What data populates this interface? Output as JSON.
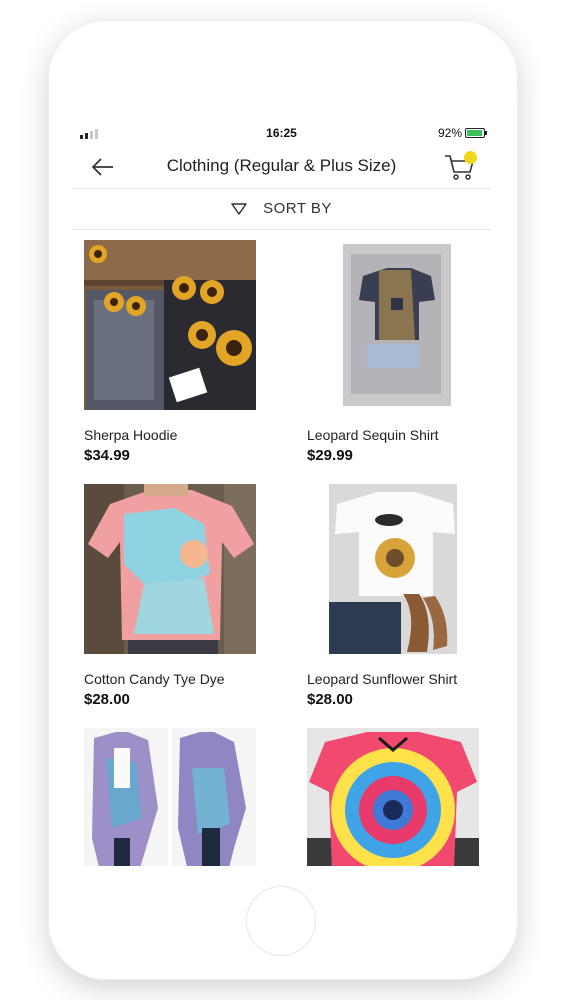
{
  "status_bar": {
    "time": "16:25",
    "battery": "92%",
    "battery_level": 0.92
  },
  "header": {
    "title": "Clothing (Regular & Plus Size)",
    "back_icon": "arrow-left-icon",
    "cart_icon": "shopping-cart-icon"
  },
  "sort": {
    "label": "SORT BY",
    "icon": "triangle-down-icon"
  },
  "products": [
    {
      "name": "Sherpa Hoodie",
      "price": "$34.99"
    },
    {
      "name": "Leopard Sequin Shirt",
      "price": "$29.99"
    },
    {
      "name": "Cotton Candy Tye Dye",
      "price": "$28.00"
    },
    {
      "name": "Leopard Sunflower Shirt",
      "price": "$28.00"
    },
    {
      "name": "",
      "price": ""
    },
    {
      "name": "",
      "price": ""
    }
  ],
  "colors": {
    "accent": "#f3d51a",
    "text": "#222222",
    "divider": "#e5e5e5",
    "battery": "#3ac15a"
  }
}
